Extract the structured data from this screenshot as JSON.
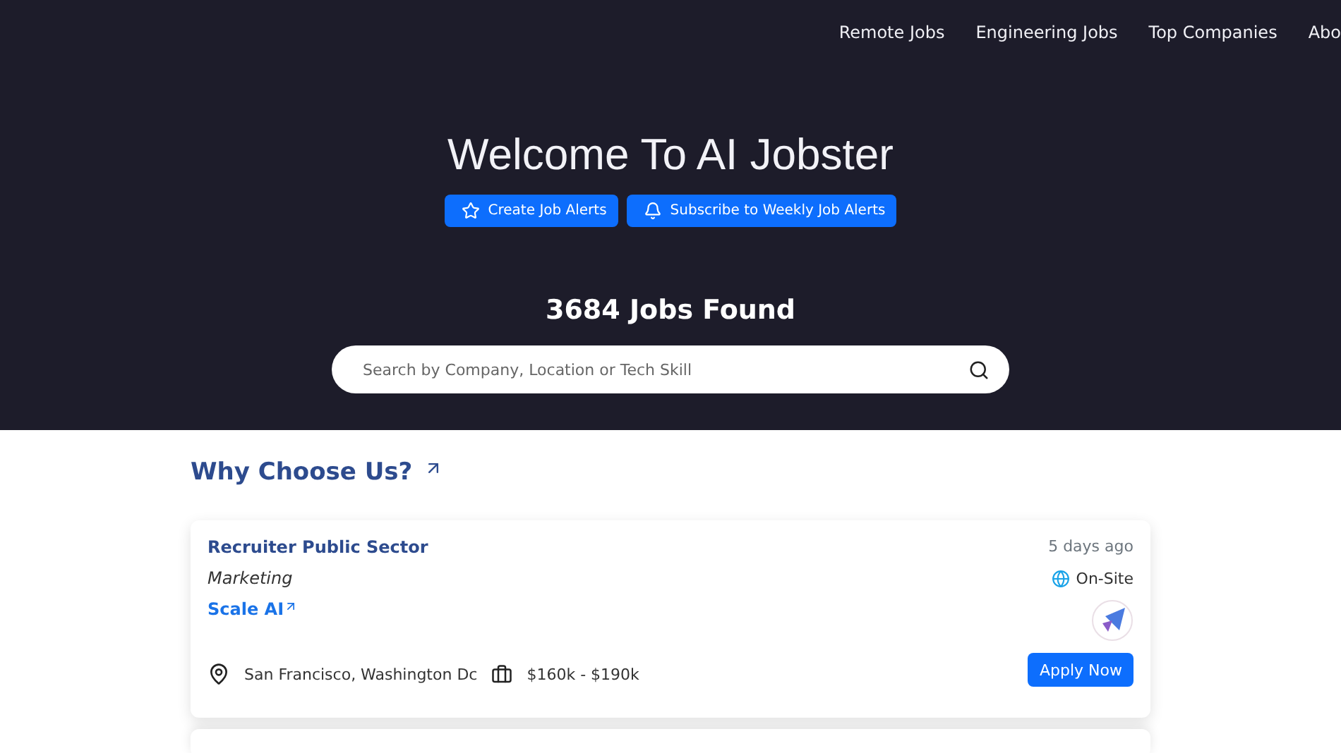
{
  "nav": {
    "links": [
      "Remote Jobs",
      "Engineering Jobs",
      "Top Companies",
      "Abo"
    ]
  },
  "hero": {
    "title": "Welcome To AI Jobster",
    "buttons": [
      {
        "label": "Create Job Alerts",
        "kind": "star"
      },
      {
        "label": "Subscribe to Weekly Job Alerts",
        "kind": "bell"
      }
    ],
    "count": "3684 Jobs Found",
    "search": {
      "placeholder": "Search by Company, Location or Tech Skill"
    }
  },
  "section": {
    "title": "Why Choose Us?"
  },
  "jobs": [
    {
      "title": "Recruiter Public Sector",
      "posted": "5 days ago",
      "category": "Marketing",
      "workplace": "On-Site",
      "company": "Scale AI",
      "location": "San Francisco, Washington Dc",
      "salary": "$160k - $190k",
      "apply": "Apply Now"
    }
  ]
}
